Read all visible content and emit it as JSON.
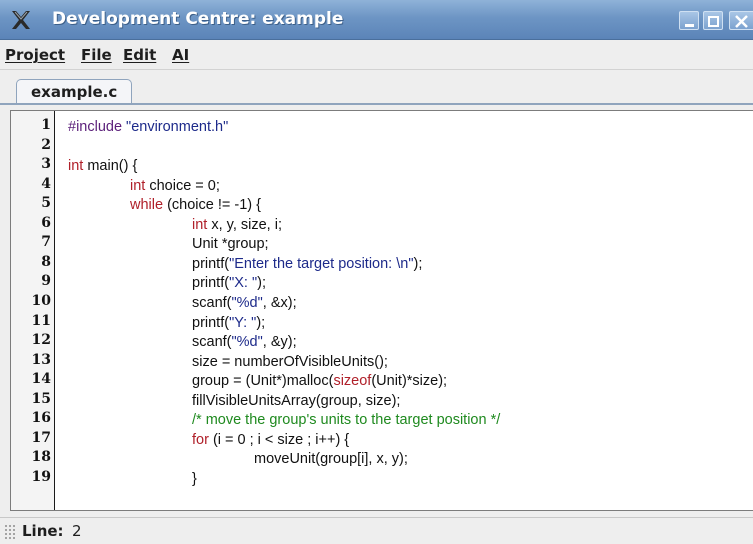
{
  "window": {
    "title": "Development Centre: example"
  },
  "menu": {
    "items": [
      {
        "label": "Project"
      },
      {
        "label": "File"
      },
      {
        "label": "Edit"
      },
      {
        "label": "AI"
      }
    ]
  },
  "tabs": [
    {
      "label": "example.c",
      "selected": true
    }
  ],
  "editor": {
    "line_numbers": [
      "1",
      "2",
      "3",
      "4",
      "5",
      "6",
      "7",
      "8",
      "9",
      "10",
      "11",
      "12",
      "13",
      "14",
      "15",
      "16",
      "17",
      "18",
      "19"
    ],
    "lines": [
      {
        "n": 1,
        "indent": 0,
        "parts": [
          {
            "t": "#include ",
            "c": "pre"
          },
          {
            "t": "\"environment.h\"",
            "c": "str"
          }
        ]
      },
      {
        "n": 2,
        "indent": 0,
        "parts": []
      },
      {
        "n": 3,
        "indent": 0,
        "parts": [
          {
            "t": "int",
            "c": "kw"
          },
          {
            "t": " main() {",
            "c": ""
          }
        ]
      },
      {
        "n": 4,
        "indent": 1,
        "parts": [
          {
            "t": "int",
            "c": "kw"
          },
          {
            "t": " choice = 0;",
            "c": ""
          }
        ]
      },
      {
        "n": 5,
        "indent": 1,
        "parts": [
          {
            "t": "while",
            "c": "kw"
          },
          {
            "t": " (choice != -1) {",
            "c": ""
          }
        ]
      },
      {
        "n": 6,
        "indent": 2,
        "parts": [
          {
            "t": "int",
            "c": "kw"
          },
          {
            "t": " x, y, size, i;",
            "c": ""
          }
        ]
      },
      {
        "n": 7,
        "indent": 2,
        "parts": [
          {
            "t": "Unit *group;",
            "c": ""
          }
        ]
      },
      {
        "n": 8,
        "indent": 2,
        "parts": [
          {
            "t": "printf(",
            "c": ""
          },
          {
            "t": "\"Enter the target position: \\n\"",
            "c": "str"
          },
          {
            "t": ");",
            "c": ""
          }
        ]
      },
      {
        "n": 9,
        "indent": 2,
        "parts": [
          {
            "t": "printf(",
            "c": ""
          },
          {
            "t": "\"X: \"",
            "c": "str"
          },
          {
            "t": ");",
            "c": ""
          }
        ]
      },
      {
        "n": 10,
        "indent": 2,
        "parts": [
          {
            "t": "scanf(",
            "c": ""
          },
          {
            "t": "\"%d\"",
            "c": "str"
          },
          {
            "t": ", &x);",
            "c": ""
          }
        ]
      },
      {
        "n": 11,
        "indent": 2,
        "parts": [
          {
            "t": "printf(",
            "c": ""
          },
          {
            "t": "\"Y: \"",
            "c": "str"
          },
          {
            "t": ");",
            "c": ""
          }
        ]
      },
      {
        "n": 12,
        "indent": 2,
        "parts": [
          {
            "t": "scanf(",
            "c": ""
          },
          {
            "t": "\"%d\"",
            "c": "str"
          },
          {
            "t": ", &y);",
            "c": ""
          }
        ]
      },
      {
        "n": 13,
        "indent": 2,
        "parts": [
          {
            "t": "size = numberOfVisibleUnits();",
            "c": ""
          }
        ]
      },
      {
        "n": 14,
        "indent": 2,
        "parts": [
          {
            "t": "group = (Unit*)malloc(",
            "c": ""
          },
          {
            "t": "sizeof",
            "c": "kw"
          },
          {
            "t": "(Unit)*size);",
            "c": ""
          }
        ]
      },
      {
        "n": 15,
        "indent": 2,
        "parts": [
          {
            "t": "fillVisibleUnitsArray(group, size);",
            "c": ""
          }
        ]
      },
      {
        "n": 16,
        "indent": 2,
        "parts": [
          {
            "t": "/* move the group's units to the target position */",
            "c": "cmt"
          }
        ]
      },
      {
        "n": 17,
        "indent": 2,
        "parts": [
          {
            "t": "for",
            "c": "kw"
          },
          {
            "t": " (i = 0 ; i < size ; i++) {",
            "c": ""
          }
        ]
      },
      {
        "n": 18,
        "indent": 3,
        "parts": [
          {
            "t": "moveUnit(group[i], x, y);",
            "c": ""
          }
        ]
      },
      {
        "n": 19,
        "indent": 2,
        "parts": [
          {
            "t": "}",
            "c": ""
          }
        ]
      }
    ]
  },
  "status": {
    "label": "Line:",
    "value": "2"
  },
  "colors": {
    "keyword": "#b0202a",
    "string": "#1d2a8a",
    "comment": "#1f8a1f",
    "preprocessor": "#5b1f7a",
    "titlebar": "#6d95c4"
  },
  "icons": {
    "app": "x-cross-icon",
    "minimize": "minimize-icon",
    "maximize": "maximize-icon",
    "close": "close-icon"
  }
}
